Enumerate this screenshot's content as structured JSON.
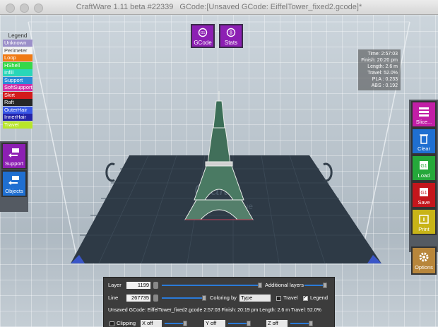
{
  "window": {
    "title": "CraftWare 1.11 beta #22339",
    "document": "GCode:[Unsaved GCode: EiffelTower_fixed2.gcode]*"
  },
  "legend": {
    "title": "Legend",
    "items": [
      {
        "label": "Unknown",
        "color": "#9b8fc9"
      },
      {
        "label": "Perimeter",
        "color": "#f4f4f4"
      },
      {
        "label": "Loop",
        "color": "#f07a14"
      },
      {
        "label": "HShell",
        "color": "#36d84a"
      },
      {
        "label": "Infill",
        "color": "#29d6b8"
      },
      {
        "label": "Support",
        "color": "#2a8ad8"
      },
      {
        "label": "SoftSupport",
        "color": "#cf2fa8"
      },
      {
        "label": "Skirt",
        "color": "#d21b1b"
      },
      {
        "label": "Raft",
        "color": "#262626"
      },
      {
        "label": "OuterHair",
        "color": "#3856e6"
      },
      {
        "label": "InnerHair",
        "color": "#2424a8"
      },
      {
        "label": "Travel",
        "color": "#b8e62a"
      }
    ]
  },
  "top_buttons": {
    "gcode": "GCode",
    "stats": "Stats"
  },
  "stats": {
    "time": "Time: 2:57:03",
    "finish": "Finish: 20:20 pm",
    "length": "Length: 2.6 m",
    "travel": "Travel: 52.0%",
    "pla": "PLA : 0.233",
    "abs": "ABS : 0.192"
  },
  "left_buttons": {
    "support": "Support",
    "objects": "Objects"
  },
  "right_buttons": {
    "slice": "Slice...",
    "clear": "Clear",
    "load": "Load",
    "save": "Save",
    "print": "Print",
    "options": "Options"
  },
  "panel": {
    "layer_label": "Layer",
    "layer_value": "1199",
    "additional_layers": "Additional layers",
    "line_label": "Line",
    "line_value": "267735",
    "coloring_by": "Coloring by",
    "coloring_value": "Type",
    "travel_label": "Travel",
    "legend_label": "Legend",
    "legend_checked": "✓",
    "info": "Unsaved GCode: EiffelTower_fixed2.gcode   2:57:03   Finish: 20:19 pm   Length: 2.6 m   Travel: 52.0%",
    "clipping_label": "Clipping",
    "x_off": "X off",
    "y_off": "Y off",
    "z_off": "Z off"
  },
  "colors": {
    "top_button": "#8c1fb3",
    "support_button": "#8c1fb3",
    "objects_button": "#1f6fd1",
    "slice_button": "#c21ea6",
    "clear_button": "#1f6fd1",
    "load_button": "#25a83a",
    "save_button": "#c4161c",
    "print_button": "#c8b418",
    "options_button": "#b8863b"
  }
}
